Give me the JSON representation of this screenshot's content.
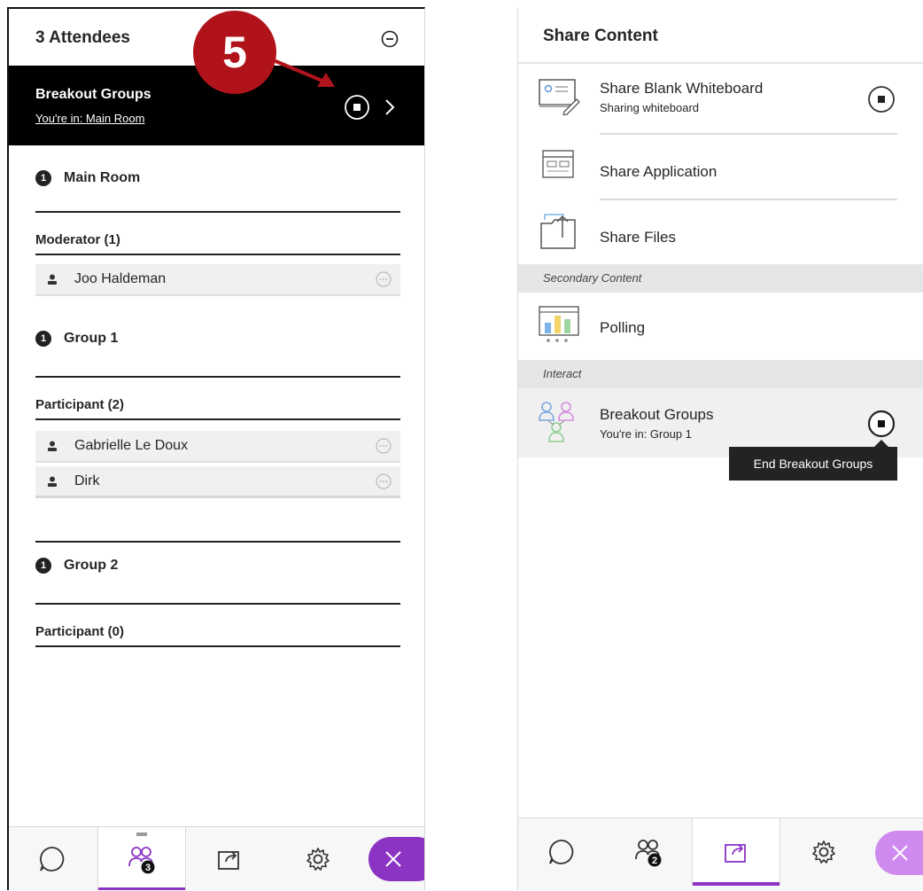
{
  "left_panel": {
    "title": "3 Attendees",
    "breakout_bar": {
      "title": "Breakout Groups",
      "subtitle": "You're in: Main Room"
    },
    "step_callout": "5",
    "groups": [
      {
        "badge": "1",
        "name": "Main Room"
      },
      {
        "badge": "1",
        "name": "Group 1"
      },
      {
        "badge": "1",
        "name": "Group 2"
      }
    ],
    "roles": {
      "main_moderator": "Moderator (1)",
      "group1_participant": "Participant (2)",
      "group2_participant": "Participant (0)"
    },
    "people": {
      "moderator": "Joo Haldeman",
      "participant_1": "Gabrielle Le Doux",
      "participant_2": "Dirk"
    },
    "tabbar": {
      "attendee_count": "3",
      "active_tab": "attendees"
    }
  },
  "right_panel": {
    "title": "Share Content",
    "items": {
      "whiteboard_label": "Share Blank Whiteboard",
      "whiteboard_sub": "Sharing whiteboard",
      "application_label": "Share Application",
      "files_label": "Share Files",
      "polling_label": "Polling",
      "breakout_label": "Breakout Groups",
      "breakout_sub": "You're in: Group 1"
    },
    "sections": {
      "secondary": "Secondary Content",
      "interact": "Interact"
    },
    "tooltip": "End Breakout Groups",
    "tabbar": {
      "attendee_count": "2",
      "active_tab": "share-content"
    }
  },
  "colors": {
    "accent_purple": "#8b34c4",
    "accent_purple_light": "#cf8af0",
    "callout_red": "#b0141a",
    "breakout_bar_bg": "#000000"
  }
}
